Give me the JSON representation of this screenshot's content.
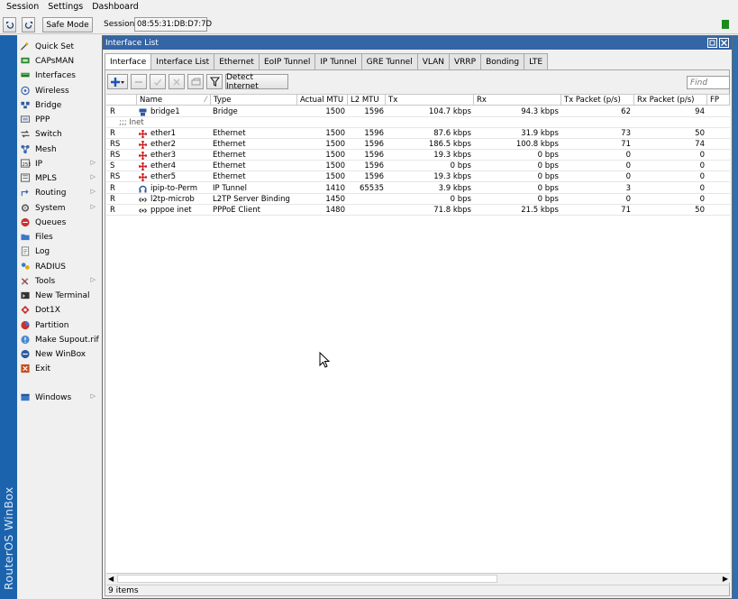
{
  "menubar": {
    "items": [
      "Session",
      "Settings",
      "Dashboard"
    ]
  },
  "toolbar": {
    "undo_icon": "undo-icon",
    "redo_icon": "redo-icon",
    "safe_mode_label": "Safe Mode",
    "session_label": "Session:",
    "session_value": "08:55:31:DB:D7:7D",
    "status_color": "#1d8a1d"
  },
  "sidebar": {
    "brand": "RouterOS WinBox",
    "items": [
      {
        "label": "Quick Set",
        "icon": "wand-icon"
      },
      {
        "label": "CAPsMAN",
        "icon": "capsman-icon"
      },
      {
        "label": "Interfaces",
        "icon": "interfaces-icon"
      },
      {
        "label": "Wireless",
        "icon": "wireless-icon"
      },
      {
        "label": "Bridge",
        "icon": "bridge-icon"
      },
      {
        "label": "PPP",
        "icon": "ppp-icon"
      },
      {
        "label": "Switch",
        "icon": "switch-icon"
      },
      {
        "label": "Mesh",
        "icon": "mesh-icon"
      },
      {
        "label": "IP",
        "icon": "ip-icon",
        "submenu": true
      },
      {
        "label": "MPLS",
        "icon": "mpls-icon",
        "submenu": true
      },
      {
        "label": "Routing",
        "icon": "routing-icon",
        "submenu": true
      },
      {
        "label": "System",
        "icon": "gear-icon",
        "submenu": true
      },
      {
        "label": "Queues",
        "icon": "queues-icon"
      },
      {
        "label": "Files",
        "icon": "folder-icon"
      },
      {
        "label": "Log",
        "icon": "log-icon"
      },
      {
        "label": "RADIUS",
        "icon": "radius-icon"
      },
      {
        "label": "Tools",
        "icon": "tools-icon",
        "submenu": true
      },
      {
        "label": "New Terminal",
        "icon": "terminal-icon"
      },
      {
        "label": "Dot1X",
        "icon": "dot1x-icon"
      },
      {
        "label": "Partition",
        "icon": "partition-icon"
      },
      {
        "label": "Make Supout.rif",
        "icon": "supout-icon"
      },
      {
        "label": "New WinBox",
        "icon": "winbox-icon"
      },
      {
        "label": "Exit",
        "icon": "exit-icon"
      },
      {
        "label": "Windows",
        "icon": "windows-icon",
        "submenu": true
      }
    ]
  },
  "window": {
    "title": "Interface List",
    "tabs": [
      "Interface",
      "Interface List",
      "Ethernet",
      "EoIP Tunnel",
      "IP Tunnel",
      "GRE Tunnel",
      "VLAN",
      "VRRP",
      "Bonding",
      "LTE"
    ],
    "active_tab": 0,
    "detect_label": "Detect Internet",
    "find_placeholder": "Find",
    "columns": [
      "Name",
      "Type",
      "Actual MTU",
      "L2 MTU",
      "Tx",
      "Rx",
      "Tx Packet (p/s)",
      "Rx Packet (p/s)",
      "FP"
    ],
    "comment": ";;; Inet",
    "rows": [
      {
        "flag": "R",
        "name": "bridge1",
        "icon": "bridge-icon",
        "type": "Bridge",
        "amtu": "1500",
        "l2mtu": "1596",
        "tx": "104.7 kbps",
        "rx": "94.3 kbps",
        "txp": "62",
        "rxp": "94"
      },
      {
        "flag": "R",
        "name": "ether1",
        "icon": "ethernet-icon",
        "type": "Ethernet",
        "amtu": "1500",
        "l2mtu": "1596",
        "tx": "87.6 kbps",
        "rx": "31.9 kbps",
        "txp": "73",
        "rxp": "50"
      },
      {
        "flag": "RS",
        "name": "ether2",
        "icon": "ethernet-icon",
        "type": "Ethernet",
        "amtu": "1500",
        "l2mtu": "1596",
        "tx": "186.5 kbps",
        "rx": "100.8 kbps",
        "txp": "71",
        "rxp": "74"
      },
      {
        "flag": "RS",
        "name": "ether3",
        "icon": "ethernet-icon",
        "type": "Ethernet",
        "amtu": "1500",
        "l2mtu": "1596",
        "tx": "19.3 kbps",
        "rx": "0 bps",
        "txp": "0",
        "rxp": "0"
      },
      {
        "flag": "S",
        "name": "ether4",
        "icon": "ethernet-icon",
        "type": "Ethernet",
        "amtu": "1500",
        "l2mtu": "1596",
        "tx": "0 bps",
        "rx": "0 bps",
        "txp": "0",
        "rxp": "0"
      },
      {
        "flag": "RS",
        "name": "ether5",
        "icon": "ethernet-icon",
        "type": "Ethernet",
        "amtu": "1500",
        "l2mtu": "1596",
        "tx": "19.3 kbps",
        "rx": "0 bps",
        "txp": "0",
        "rxp": "0"
      },
      {
        "flag": "R",
        "name": "ipip-to-Perm",
        "icon": "tunnel-icon",
        "type": "IP Tunnel",
        "amtu": "1410",
        "l2mtu": "65535",
        "tx": "3.9 kbps",
        "rx": "0 bps",
        "txp": "3",
        "rxp": "0"
      },
      {
        "flag": "R",
        "name": "l2tp-microb",
        "icon": "ppp-link-icon",
        "type": "L2TP Server Binding",
        "amtu": "1450",
        "l2mtu": "",
        "tx": "0 bps",
        "rx": "0 bps",
        "txp": "0",
        "rxp": "0"
      },
      {
        "flag": "R",
        "name": "pppoe inet",
        "icon": "ppp-link-icon",
        "type": "PPPoE Client",
        "amtu": "1480",
        "l2mtu": "",
        "tx": "71.8 kbps",
        "rx": "21.5 kbps",
        "txp": "71",
        "rxp": "50"
      }
    ],
    "status": "9 items"
  }
}
